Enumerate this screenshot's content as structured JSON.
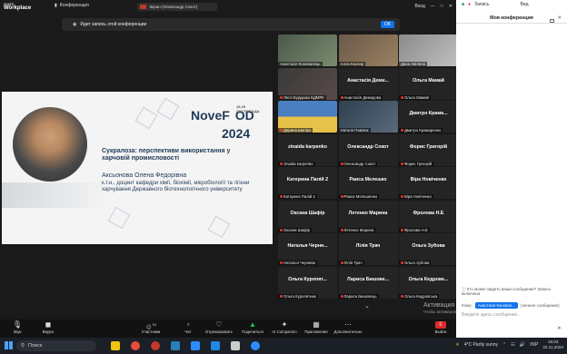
{
  "window": {
    "logo_small": "zoom",
    "logo_big": "Workplace",
    "conference_label": "Конференция",
    "screen_share_label": "Экран (Олександр Сокот)",
    "login_label": "Вход",
    "rec_label": "Запись",
    "view_label": "Вид"
  },
  "recording_banner": {
    "text": "Идет запись этой конференции",
    "ok_label": "OK"
  },
  "slide": {
    "brand_left": "NoveF",
    "brand_right": "OD",
    "year": "2024",
    "dates": "18-29 ЛИСТОПАДА",
    "title": "Сукралоза: перспективи використання у харчовій промисловості",
    "speaker_name": "Аксьонова Олена Федорівна",
    "speaker_position": "к.т.н., доцент кафедри хімії, біохімії, мікробіології та гігієни харчування Державного біотехнологічного університету"
  },
  "participants": [
    {
      "big": "",
      "name": "Анастасія Коновалець",
      "video": true,
      "muted": false
    },
    {
      "big": "",
      "name": "Алла Каспар",
      "video": true,
      "muted": false
    },
    {
      "big": "",
      "name": "Дана Авілена",
      "video": true,
      "muted": false
    },
    {
      "big": "",
      "name": "Леся Бурдюжа БДМРК",
      "video": true,
      "muted": true
    },
    {
      "big": "Анастасія Деми...",
      "name": "Анастасія Демидова",
      "video": false,
      "muted": true
    },
    {
      "big": "Ольга Мамай",
      "name": "Ольга Мамай",
      "video": false,
      "muted": true
    },
    {
      "big": "",
      "name": "Дарина Шапіро",
      "video": true,
      "muted": true
    },
    {
      "big": "",
      "name": "Наталя Павлюк",
      "video": true,
      "muted": false
    },
    {
      "big": "Дмитро Крама...",
      "name": "Дмитро Крамаренко",
      "video": false,
      "muted": true
    },
    {
      "big": "zinaida karpenko",
      "name": "zinaida karpenko",
      "video": false,
      "muted": true
    },
    {
      "big": "Олександр Сокот",
      "name": "Олександр Сокот",
      "video": false,
      "muted": true
    },
    {
      "big": "Форис Григорій",
      "name": "Форис Григорій",
      "video": false,
      "muted": true
    },
    {
      "big": "Катерина Палій 2",
      "name": "Катерина Палій 2",
      "video": false,
      "muted": true
    },
    {
      "big": "Раиса Мелешко",
      "name": "Раиса Мелешенко",
      "video": false,
      "muted": true
    },
    {
      "big": "Віра Новіченко",
      "name": "Віра Новіченко",
      "video": false,
      "muted": true
    },
    {
      "big": "Оксана Шафір",
      "name": "Оксана Шафір",
      "video": false,
      "muted": true
    },
    {
      "big": "Летенко Марина",
      "name": "Летенко Марина",
      "video": false,
      "muted": true
    },
    {
      "big": "Фролова Н.Е",
      "name": "Фролова Н.Е",
      "video": false,
      "muted": true
    },
    {
      "big": "Наталья Черня...",
      "name": "Наталья Чернява",
      "video": false,
      "muted": true
    },
    {
      "big": "Лілія Трач",
      "name": "Лілія Трач",
      "video": false,
      "muted": true
    },
    {
      "big": "Ольга Зубова",
      "name": "Ольга Зубова",
      "video": false,
      "muted": true
    },
    {
      "big": "Ольга Куропят...",
      "name": "Ольга Куропятник",
      "video": false,
      "muted": true
    },
    {
      "big": "Лариса Бишове...",
      "name": "Лариса Бишовець",
      "video": false,
      "muted": true
    },
    {
      "big": "Ольга Кедрове...",
      "name": "Ольга Кедровська",
      "video": false,
      "muted": true
    }
  ],
  "activation": {
    "title": "Активация",
    "sub": "Чтобы активировать Windows, перейдите в \"Параметры\"."
  },
  "toolbar": {
    "audio": "Звук",
    "video": "Видео",
    "participants": "Участники",
    "participants_count": "51",
    "chat": "Чат",
    "react": "Отреагировать",
    "share": "Поделиться",
    "ai": "AI Companion",
    "apps": "Приложения",
    "more": "Дополнительно",
    "leave": "Выйти",
    "end_icon": "Ё"
  },
  "chat_panel": {
    "title": "Моя конференция",
    "who_can_see": "Кто может видеть ваши сообщения? Запись включена",
    "to_label": "Кому:",
    "recipient": "Анастасія Коновал...",
    "direct_note": "(личное сообщение)",
    "input_placeholder": "Введите здесь сообщение..."
  },
  "taskbar": {
    "search_label": "Поиск",
    "weather": "4°C  Partly sunny",
    "lang": "УКР",
    "time": "15:03",
    "date": "22.11.2024"
  }
}
